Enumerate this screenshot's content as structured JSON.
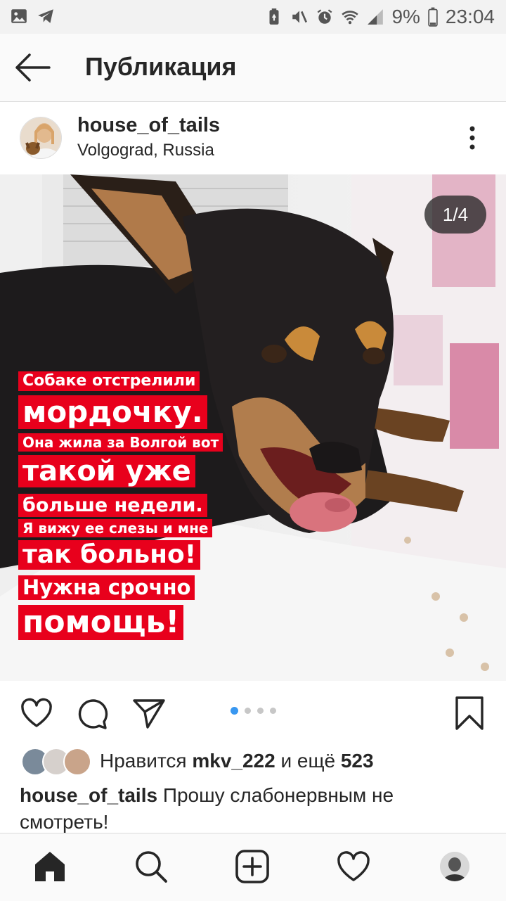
{
  "status_bar": {
    "battery": "9%",
    "time": "23:04"
  },
  "app_bar": {
    "title": "Публикация"
  },
  "post": {
    "username": "house_of_tails",
    "location": "Volgograd, Russia",
    "counter": "1/4",
    "overlay_lines": [
      "Собаке отстрелили",
      "мордочку.",
      "Она жила за Волгой вот",
      "такой уже",
      "больше недели.",
      "Я вижу ее слезы и мне",
      "так больно!",
      "Нужна срочно",
      "помощь!"
    ],
    "carousel_dots": 4,
    "active_dot": 1
  },
  "likes": {
    "prefix": "Нравится",
    "user": "mkv_222",
    "middle": "и ещё",
    "count": "523"
  },
  "caption": {
    "username": "house_of_tails",
    "text": "Прошу слабонервным не смотреть!"
  },
  "icons": [
    "image-icon",
    "telegram-icon",
    "battery-saver-icon",
    "mute-icon",
    "alarm-icon",
    "wifi-icon",
    "signal-icon",
    "battery-icon",
    "back-arrow-icon",
    "more-vert-icon",
    "heart-icon",
    "comment-icon",
    "share-icon",
    "bookmark-icon",
    "home-icon",
    "search-icon",
    "add-icon",
    "activity-icon",
    "profile-icon"
  ]
}
